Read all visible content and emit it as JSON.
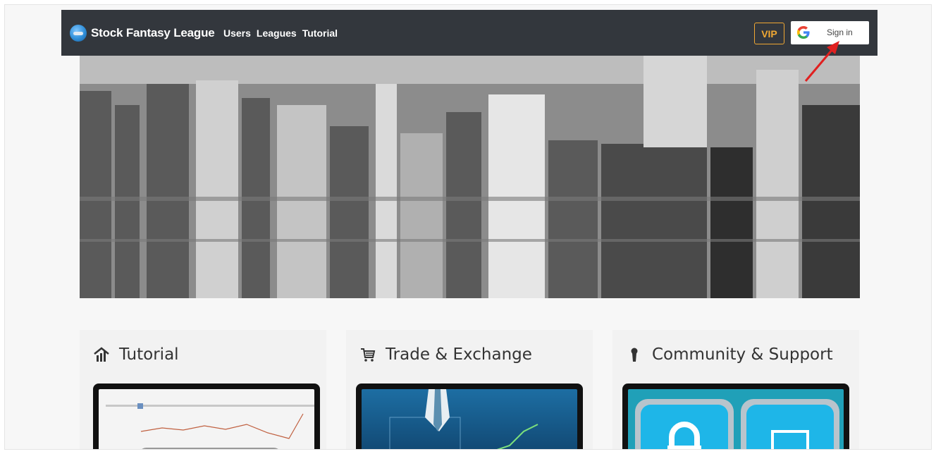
{
  "navbar": {
    "brand": "Stock Fantasy League",
    "links": [
      "Users",
      "Leagues",
      "Tutorial"
    ],
    "vip_label": "VIP",
    "signin_label": "Sign in",
    "signin_icon": "google-icon"
  },
  "hero": {
    "image": "city-skyline-photo"
  },
  "cards": [
    {
      "title": "Tutorial",
      "icon": "chart-bars-icon",
      "image": "stock-chart-screenshot"
    },
    {
      "title": "Trade & Exchange",
      "icon": "shopping-cart-icon",
      "image": "businessman-trading-photo"
    },
    {
      "title": "Community & Support",
      "icon": "keyhole-icon",
      "image": "lock-app-icons"
    }
  ],
  "colors": {
    "navbar_bg": "#33373d",
    "vip_accent": "#f0a833",
    "annotation_arrow": "#e02020"
  }
}
